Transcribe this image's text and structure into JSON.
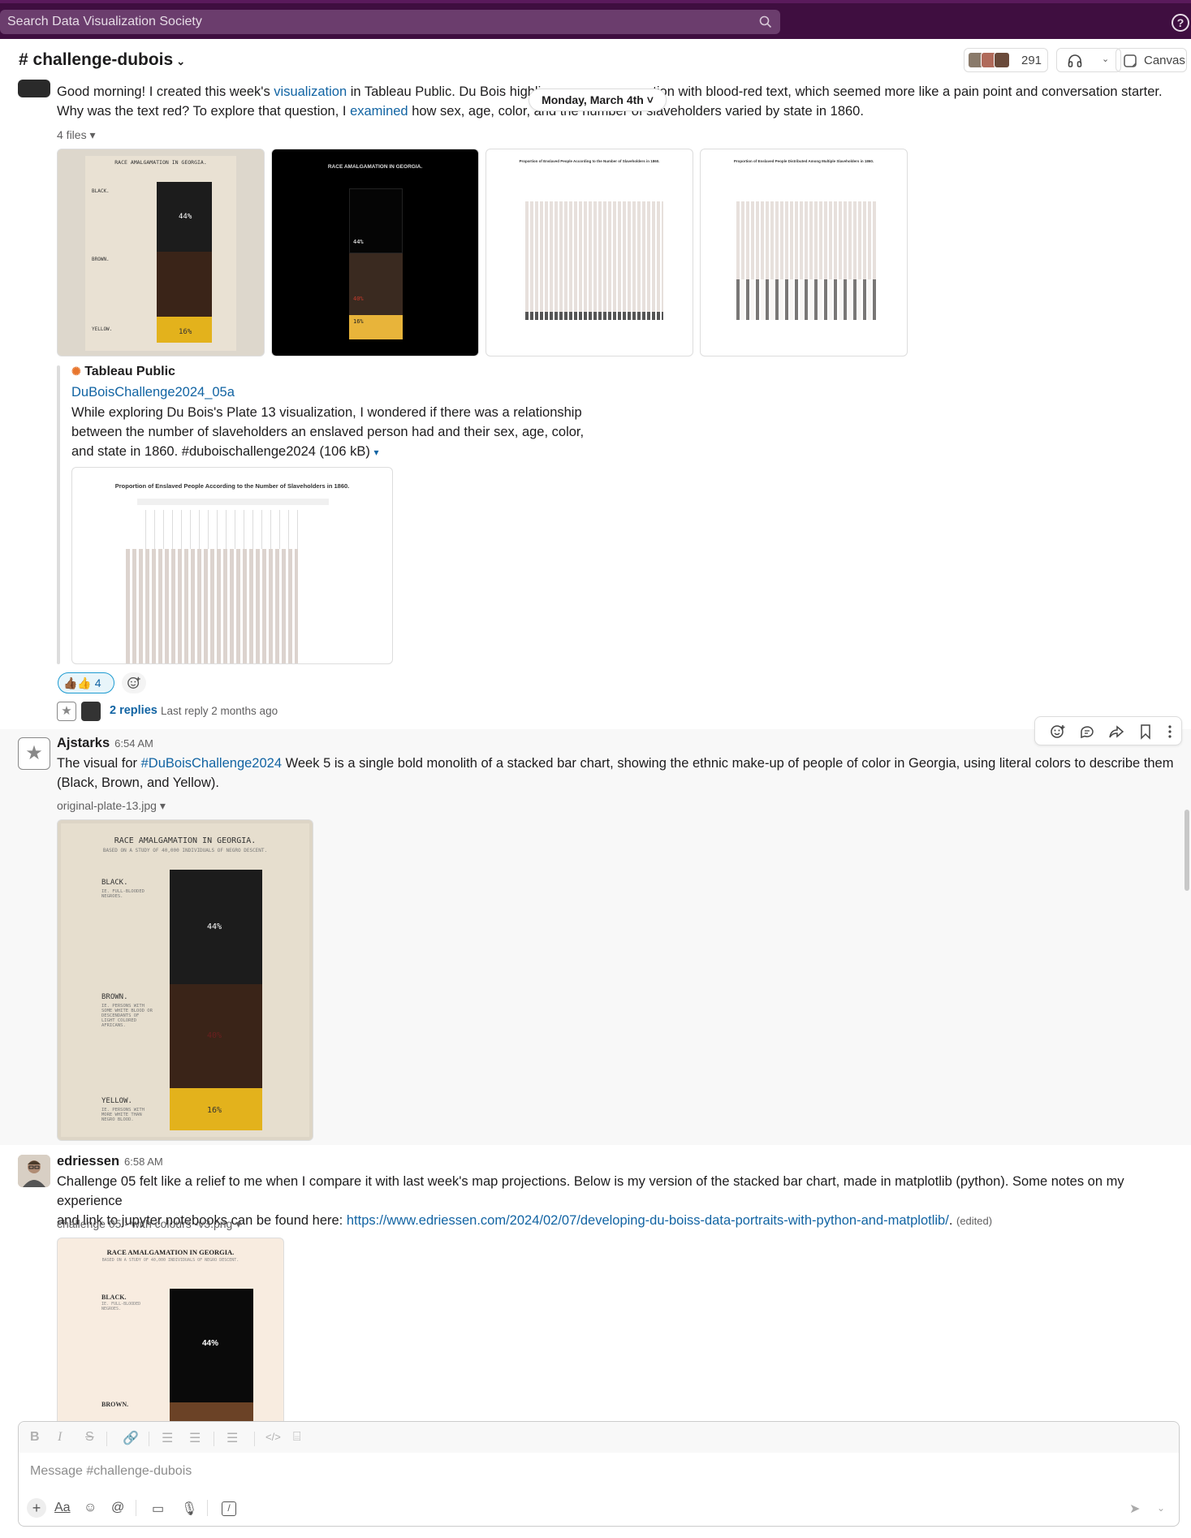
{
  "search": {
    "placeholder": "Search Data Visualization Society"
  },
  "channel": {
    "title": "# challenge-dubois",
    "member_count": "291",
    "canvas_label": "Canvas"
  },
  "date_divider": "Monday, March 4th ˅",
  "msg1": {
    "text_a": "Good morning! I created this week's ",
    "link_a": "visualization",
    "text_b": " in Tableau Public. Du Bois highli",
    "text_c": "tion with blood-red text, which seemed more like a pain point and conversation starter.",
    "text_d": "Why was the text red? To explore that question, I ",
    "link_b": "examined",
    "text_e": " how sex, age, color, and the number of slaveholders varied by state in 1860.",
    "files_label": "4 files",
    "unfurl_source": "Tableau Public",
    "unfurl_title": "DuBoisChallenge2024_05a",
    "unfurl_desc_1": "While exploring Du Bois's Plate 13 visualization, I wondered if there was a relationship",
    "unfurl_desc_2": "between the number of slaveholders an enslaved person had and their sex, age, color,",
    "unfurl_desc_3": "and state in 1860. #duboischallenge2024 (106 kB)",
    "reaction": "👍🏾👍 4",
    "replies": "2 replies",
    "last_reply": "Last reply 2 months ago",
    "thumb3_title": "Proportion of Enslaved People According to the Number of Slaveholders in 1860.",
    "thumb4_title": "Proportion of Enslaved People Distributed Among Multiple Slaveholders in 1860.",
    "preview_title": "Proportion of Enslaved People According to the Number of Slaveholders in 1860."
  },
  "msg2": {
    "author": "Ajstarks",
    "time": "6:54 AM",
    "text_a": "The visual for ",
    "link_a": "#DuBoisChallenge2024",
    "text_b": " Week 5 is a single bold monolith of a stacked bar chart, showing the ethnic make-up of people of color in Georgia, using literal colors to describe them",
    "text_c": "(Black, Brown, and Yellow).",
    "file_name": "original-plate-13.jpg"
  },
  "msg3": {
    "author": "edriessen",
    "time": "6:58 AM",
    "text_a": "Challenge 05 felt like a relief to me when I compare it with last week's map projections. Below is my version of the stacked bar chart, made in matplotlib (python). Some notes on my experience",
    "text_b": "and link to jupyter notebooks can be found here: ",
    "link_a": "https://www.edriessen.com/2024/02/07/developing-du-boiss-data-portraits-with-python-and-matplotlib/",
    "text_c": ".",
    "edited": "(edited)",
    "file_name": "challenge 05 - with colours -v3.png"
  },
  "plate": {
    "title": "RACE AMALGAMATION IN GEORGIA.",
    "subtitle": "BASED ON A STUDY OF 40,000 INDIVIDUALS OF NEGRO DESCENT.",
    "black": "BLACK.",
    "brown": "BROWN.",
    "yellow": "YELLOW.",
    "black_pct": "44%",
    "brown_pct": "40%",
    "yellow_pct": "16%",
    "black_note": "IE. FULL-BLOODED NEGROES.",
    "brown_note": "IE. PERSONS WITH SOME WHITE BLOOD OR DESCENDANTS OF LIGHT COLORED AFRICANS.",
    "yellow_note": "IE. PERSONS WITH MORE WHITE THAN NEGRO BLOOD."
  },
  "composer": {
    "placeholder": "Message #challenge-dubois"
  },
  "colors": {
    "aubergine": "#3f0e40",
    "link": "#1264a3",
    "black": "#1c1c1c",
    "brown": "#4a3022",
    "yellow": "#e8b61e"
  }
}
